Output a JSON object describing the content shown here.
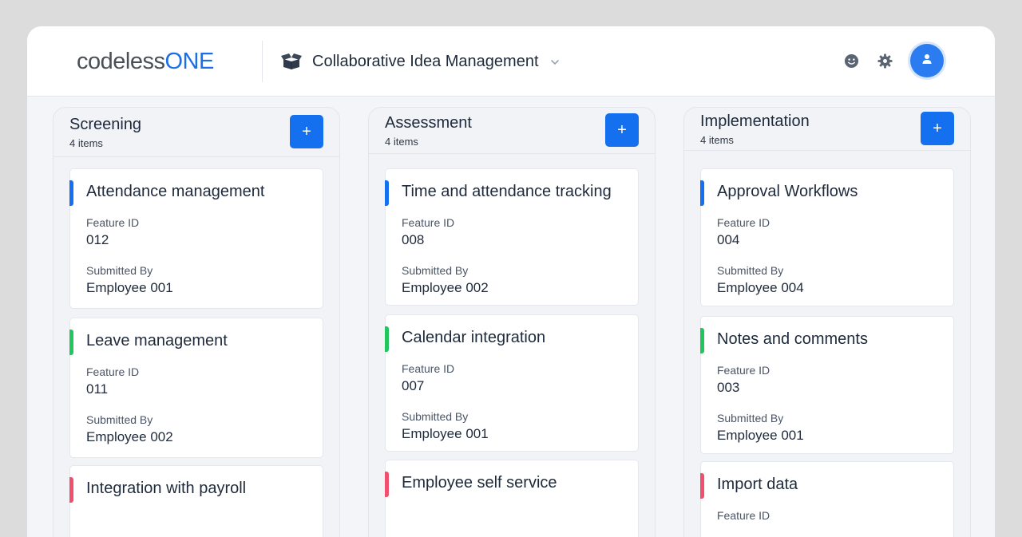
{
  "header": {
    "logo_primary": "codeless",
    "logo_accent": "ONE",
    "app_title": "Collaborative Idea Management",
    "icons": [
      "smiley-icon",
      "gear-icon",
      "user-icon"
    ]
  },
  "colors": {
    "accent": "#1570ef",
    "bar_blue": "#1570ef",
    "bar_green": "#22c55e",
    "bar_red": "#f0506e"
  },
  "labels": {
    "feature_id": "Feature ID",
    "submitted_by": "Submitted By",
    "add": "+"
  },
  "columns": [
    {
      "title": "Screening",
      "count": "4 items",
      "cards": [
        {
          "title": "Attendance management",
          "feature_id": "012",
          "submitted_by": "Employee 001",
          "status_color": "blue"
        },
        {
          "title": "Leave management",
          "feature_id": "011",
          "submitted_by": "Employee 002",
          "status_color": "green"
        },
        {
          "title": "Integration with payroll",
          "status_color": "red"
        }
      ]
    },
    {
      "title": "Assessment",
      "count": "4 items",
      "cards": [
        {
          "title": "Time and attendance tracking",
          "feature_id": "008",
          "submitted_by": "Employee 002",
          "status_color": "blue"
        },
        {
          "title": "Calendar integration",
          "feature_id": "007",
          "submitted_by": "Employee 001",
          "status_color": "green"
        },
        {
          "title": "Employee self service",
          "status_color": "red"
        }
      ]
    },
    {
      "title": "Implementation",
      "count": "4 items",
      "cards": [
        {
          "title": "Approval Workflows",
          "feature_id": "004",
          "submitted_by": "Employee 004",
          "status_color": "blue"
        },
        {
          "title": "Notes and comments",
          "feature_id": "003",
          "submitted_by": "Employee 001",
          "status_color": "green"
        },
        {
          "title": "Import data",
          "status_color": "red"
        }
      ]
    }
  ]
}
